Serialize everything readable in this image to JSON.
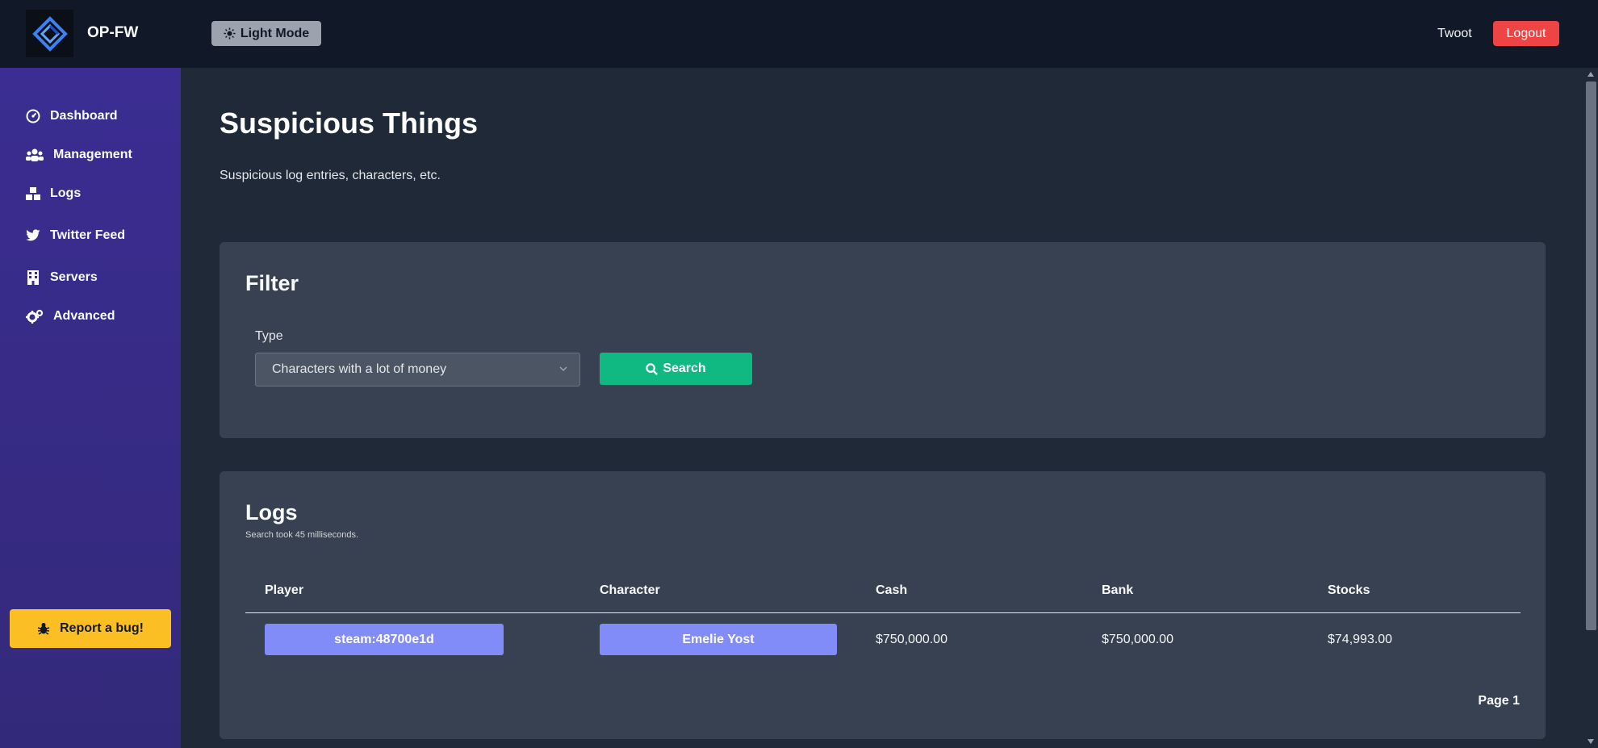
{
  "app": {
    "brand": "OP-FW"
  },
  "header": {
    "theme_toggle": "Light Mode",
    "user": "Twoot",
    "logout": "Logout"
  },
  "sidebar": {
    "items": [
      {
        "label": "Dashboard",
        "icon": "dashboard-icon"
      },
      {
        "label": "Management",
        "icon": "users-icon"
      },
      {
        "label": "Logs",
        "icon": "boxes-icon"
      },
      {
        "label": "Twitter Feed",
        "icon": "twitter-icon"
      },
      {
        "label": "Servers",
        "icon": "building-icon"
      },
      {
        "label": "Advanced",
        "icon": "cogs-icon"
      }
    ],
    "bug_button": "Report a bug!"
  },
  "page": {
    "title": "Suspicious Things",
    "subtitle": "Suspicious log entries, characters, etc."
  },
  "filter": {
    "title": "Filter",
    "type_label": "Type",
    "type_value": "Characters with a lot of money",
    "search_button": "Search"
  },
  "logs": {
    "title": "Logs",
    "search_took": "Search took 45 milliseconds.",
    "columns": [
      "Player",
      "Character",
      "Cash",
      "Bank",
      "Stocks"
    ],
    "rows": [
      {
        "player": "steam:48700e1d",
        "character": "Emelie Yost",
        "cash": "$750,000.00",
        "bank": "$750,000.00",
        "stocks": "$74,993.00"
      }
    ],
    "page": "Page 1"
  },
  "colors": {
    "accent_green": "#10b981",
    "accent_indigo": "#818cf8",
    "danger": "#ef4444",
    "warning": "#fbbf24",
    "sidebar": "#3b2d92"
  }
}
